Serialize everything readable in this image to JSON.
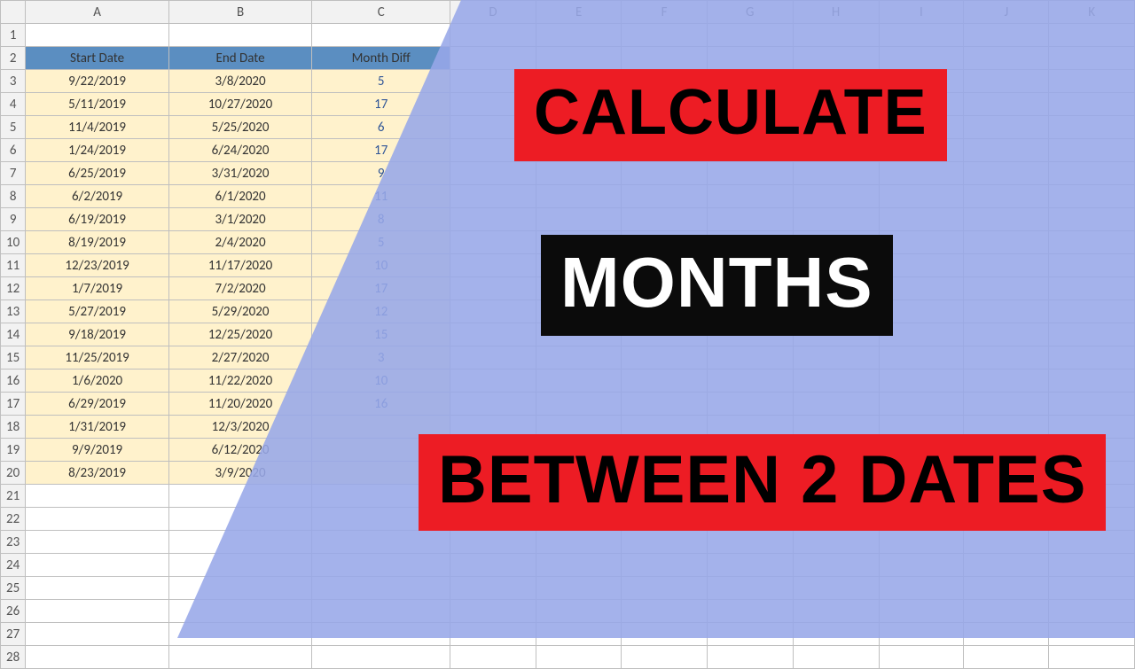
{
  "columns": [
    "A",
    "B",
    "C",
    "D",
    "E",
    "F",
    "G",
    "H",
    "I",
    "J",
    "K"
  ],
  "headers": {
    "a": "Start Date",
    "b": "End Date",
    "c": "Month Diff"
  },
  "rows": [
    {
      "start": "9/22/2019",
      "end": "3/8/2020",
      "diff": "5"
    },
    {
      "start": "5/11/2019",
      "end": "10/27/2020",
      "diff": "17"
    },
    {
      "start": "11/4/2019",
      "end": "5/25/2020",
      "diff": "6"
    },
    {
      "start": "1/24/2019",
      "end": "6/24/2020",
      "diff": "17"
    },
    {
      "start": "6/25/2019",
      "end": "3/31/2020",
      "diff": "9"
    },
    {
      "start": "6/2/2019",
      "end": "6/1/2020",
      "diff": "11"
    },
    {
      "start": "6/19/2019",
      "end": "3/1/2020",
      "diff": "8"
    },
    {
      "start": "8/19/2019",
      "end": "2/4/2020",
      "diff": "5"
    },
    {
      "start": "12/23/2019",
      "end": "11/17/2020",
      "diff": "10"
    },
    {
      "start": "1/7/2019",
      "end": "7/2/2020",
      "diff": "17"
    },
    {
      "start": "5/27/2019",
      "end": "5/29/2020",
      "diff": "12"
    },
    {
      "start": "9/18/2019",
      "end": "12/25/2020",
      "diff": "15"
    },
    {
      "start": "11/25/2019",
      "end": "2/27/2020",
      "diff": "3"
    },
    {
      "start": "1/6/2020",
      "end": "11/22/2020",
      "diff": "10"
    },
    {
      "start": "6/29/2019",
      "end": "11/20/2020",
      "diff": "16"
    },
    {
      "start": "1/31/2019",
      "end": "12/3/2020",
      "diff": ""
    },
    {
      "start": "9/9/2019",
      "end": "6/12/2020",
      "diff": ""
    },
    {
      "start": "8/23/2019",
      "end": "3/9/2020",
      "diff": ""
    }
  ],
  "labels": {
    "calc": "CALCULATE",
    "months": "MONTHS",
    "between": "BETWEEN 2 DATES"
  }
}
